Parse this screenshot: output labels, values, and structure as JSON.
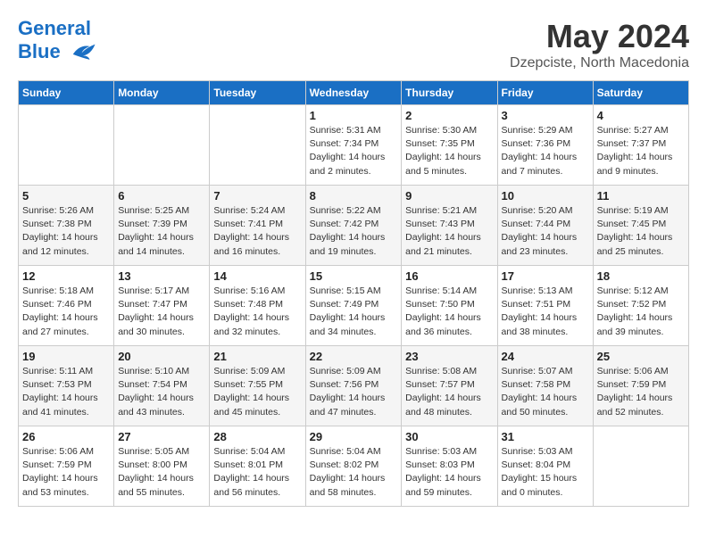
{
  "header": {
    "logo_line1": "General",
    "logo_line2": "Blue",
    "month_year": "May 2024",
    "location": "Dzepciste, North Macedonia"
  },
  "days_of_week": [
    "Sunday",
    "Monday",
    "Tuesday",
    "Wednesday",
    "Thursday",
    "Friday",
    "Saturday"
  ],
  "weeks": [
    [
      {
        "day": "",
        "info": ""
      },
      {
        "day": "",
        "info": ""
      },
      {
        "day": "",
        "info": ""
      },
      {
        "day": "1",
        "info": "Sunrise: 5:31 AM\nSunset: 7:34 PM\nDaylight: 14 hours\nand 2 minutes."
      },
      {
        "day": "2",
        "info": "Sunrise: 5:30 AM\nSunset: 7:35 PM\nDaylight: 14 hours\nand 5 minutes."
      },
      {
        "day": "3",
        "info": "Sunrise: 5:29 AM\nSunset: 7:36 PM\nDaylight: 14 hours\nand 7 minutes."
      },
      {
        "day": "4",
        "info": "Sunrise: 5:27 AM\nSunset: 7:37 PM\nDaylight: 14 hours\nand 9 minutes."
      }
    ],
    [
      {
        "day": "5",
        "info": "Sunrise: 5:26 AM\nSunset: 7:38 PM\nDaylight: 14 hours\nand 12 minutes."
      },
      {
        "day": "6",
        "info": "Sunrise: 5:25 AM\nSunset: 7:39 PM\nDaylight: 14 hours\nand 14 minutes."
      },
      {
        "day": "7",
        "info": "Sunrise: 5:24 AM\nSunset: 7:41 PM\nDaylight: 14 hours\nand 16 minutes."
      },
      {
        "day": "8",
        "info": "Sunrise: 5:22 AM\nSunset: 7:42 PM\nDaylight: 14 hours\nand 19 minutes."
      },
      {
        "day": "9",
        "info": "Sunrise: 5:21 AM\nSunset: 7:43 PM\nDaylight: 14 hours\nand 21 minutes."
      },
      {
        "day": "10",
        "info": "Sunrise: 5:20 AM\nSunset: 7:44 PM\nDaylight: 14 hours\nand 23 minutes."
      },
      {
        "day": "11",
        "info": "Sunrise: 5:19 AM\nSunset: 7:45 PM\nDaylight: 14 hours\nand 25 minutes."
      }
    ],
    [
      {
        "day": "12",
        "info": "Sunrise: 5:18 AM\nSunset: 7:46 PM\nDaylight: 14 hours\nand 27 minutes."
      },
      {
        "day": "13",
        "info": "Sunrise: 5:17 AM\nSunset: 7:47 PM\nDaylight: 14 hours\nand 30 minutes."
      },
      {
        "day": "14",
        "info": "Sunrise: 5:16 AM\nSunset: 7:48 PM\nDaylight: 14 hours\nand 32 minutes."
      },
      {
        "day": "15",
        "info": "Sunrise: 5:15 AM\nSunset: 7:49 PM\nDaylight: 14 hours\nand 34 minutes."
      },
      {
        "day": "16",
        "info": "Sunrise: 5:14 AM\nSunset: 7:50 PM\nDaylight: 14 hours\nand 36 minutes."
      },
      {
        "day": "17",
        "info": "Sunrise: 5:13 AM\nSunset: 7:51 PM\nDaylight: 14 hours\nand 38 minutes."
      },
      {
        "day": "18",
        "info": "Sunrise: 5:12 AM\nSunset: 7:52 PM\nDaylight: 14 hours\nand 39 minutes."
      }
    ],
    [
      {
        "day": "19",
        "info": "Sunrise: 5:11 AM\nSunset: 7:53 PM\nDaylight: 14 hours\nand 41 minutes."
      },
      {
        "day": "20",
        "info": "Sunrise: 5:10 AM\nSunset: 7:54 PM\nDaylight: 14 hours\nand 43 minutes."
      },
      {
        "day": "21",
        "info": "Sunrise: 5:09 AM\nSunset: 7:55 PM\nDaylight: 14 hours\nand 45 minutes."
      },
      {
        "day": "22",
        "info": "Sunrise: 5:09 AM\nSunset: 7:56 PM\nDaylight: 14 hours\nand 47 minutes."
      },
      {
        "day": "23",
        "info": "Sunrise: 5:08 AM\nSunset: 7:57 PM\nDaylight: 14 hours\nand 48 minutes."
      },
      {
        "day": "24",
        "info": "Sunrise: 5:07 AM\nSunset: 7:58 PM\nDaylight: 14 hours\nand 50 minutes."
      },
      {
        "day": "25",
        "info": "Sunrise: 5:06 AM\nSunset: 7:59 PM\nDaylight: 14 hours\nand 52 minutes."
      }
    ],
    [
      {
        "day": "26",
        "info": "Sunrise: 5:06 AM\nSunset: 7:59 PM\nDaylight: 14 hours\nand 53 minutes."
      },
      {
        "day": "27",
        "info": "Sunrise: 5:05 AM\nSunset: 8:00 PM\nDaylight: 14 hours\nand 55 minutes."
      },
      {
        "day": "28",
        "info": "Sunrise: 5:04 AM\nSunset: 8:01 PM\nDaylight: 14 hours\nand 56 minutes."
      },
      {
        "day": "29",
        "info": "Sunrise: 5:04 AM\nSunset: 8:02 PM\nDaylight: 14 hours\nand 58 minutes."
      },
      {
        "day": "30",
        "info": "Sunrise: 5:03 AM\nSunset: 8:03 PM\nDaylight: 14 hours\nand 59 minutes."
      },
      {
        "day": "31",
        "info": "Sunrise: 5:03 AM\nSunset: 8:04 PM\nDaylight: 15 hours\nand 0 minutes."
      },
      {
        "day": "",
        "info": ""
      }
    ]
  ]
}
